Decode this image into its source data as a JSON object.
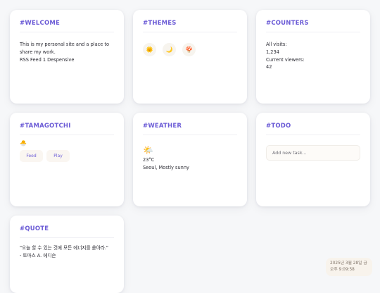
{
  "welcome": {
    "title": "#WELCOME",
    "line1": "This is my personal site and a place to",
    "line2": "share my work.",
    "line3": "RSS Feed 1 Despensive"
  },
  "themes": {
    "title": "#THEMES",
    "buttons": [
      {
        "icon": "sun-icon",
        "glyph": "🌞"
      },
      {
        "icon": "moon-icon",
        "glyph": "🌙"
      },
      {
        "icon": "mushroom-icon",
        "glyph": "🍄"
      }
    ]
  },
  "counters": {
    "title": "#COUNTERS",
    "all_visits_label": "All visits:",
    "all_visits_value": "1,234",
    "current_viewers_label": "Current viewers:",
    "current_viewers_value": "42"
  },
  "tamagotchi": {
    "title": "#TAMAGOTCHI",
    "pet_icon": "chick-icon",
    "pet_glyph": "🐣",
    "feed_label": "Feed",
    "play_label": "Play"
  },
  "weather": {
    "title": "#WEATHER",
    "icon": "sun-behind-cloud-icon",
    "glyph": "🌤️",
    "temperature": "23°C",
    "location": "Seoul, Mostly sunny"
  },
  "todo": {
    "title": "#TODO",
    "placeholder": "Add new task..."
  },
  "quote": {
    "title": "#QUOTE",
    "text": "\"오늘 할 수 있는 것에 모든 에너지를 쏟아라.\"",
    "author": "- 토마스 A. 에디슨"
  },
  "clock": {
    "date": "2025년 3월 28일 금",
    "time": "오후 9:09:58"
  }
}
